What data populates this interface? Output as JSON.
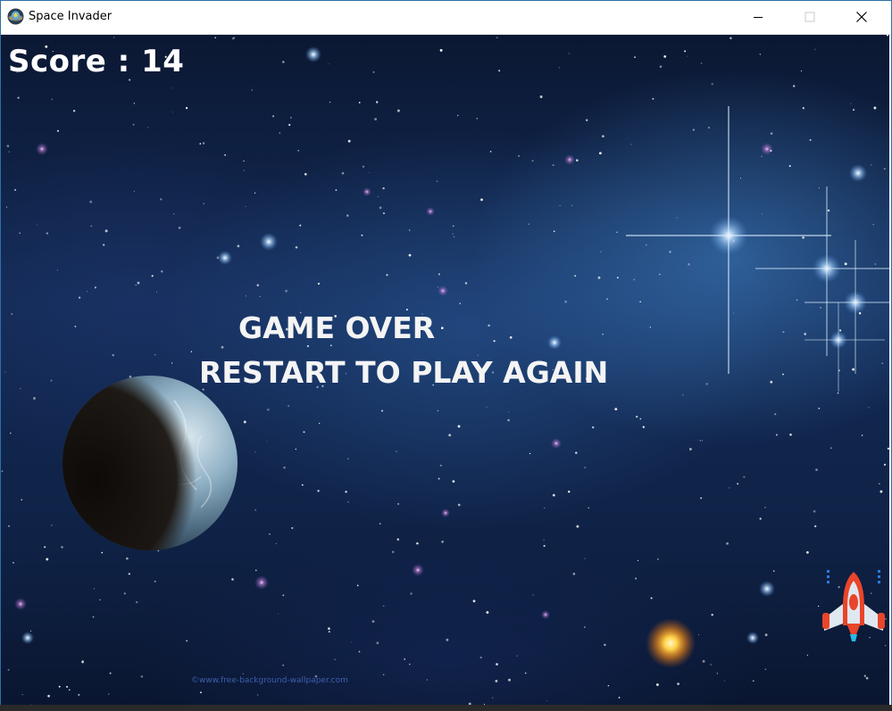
{
  "window": {
    "title": "Space Invader",
    "icons": {
      "app": "ufo-icon",
      "minimize": "minimize-icon",
      "maximize": "maximize-icon",
      "close": "close-icon"
    }
  },
  "game": {
    "score_text": "Score : 14",
    "game_over_text": "GAME OVER",
    "restart_text": "RESTART TO PLAY AGAIN",
    "watermark_text": "©www.free-background-wallpaper.com",
    "sprites": {
      "planet": "planet-sprite",
      "player": "player-spaceship-sprite",
      "sun": "glowing-star-sprite"
    }
  },
  "colors": {
    "text": "#ffffff",
    "titlebar": "#ffffff",
    "space": "#0f2246",
    "ship_red": "#e8452a",
    "ship_body": "#dfe8f0"
  }
}
